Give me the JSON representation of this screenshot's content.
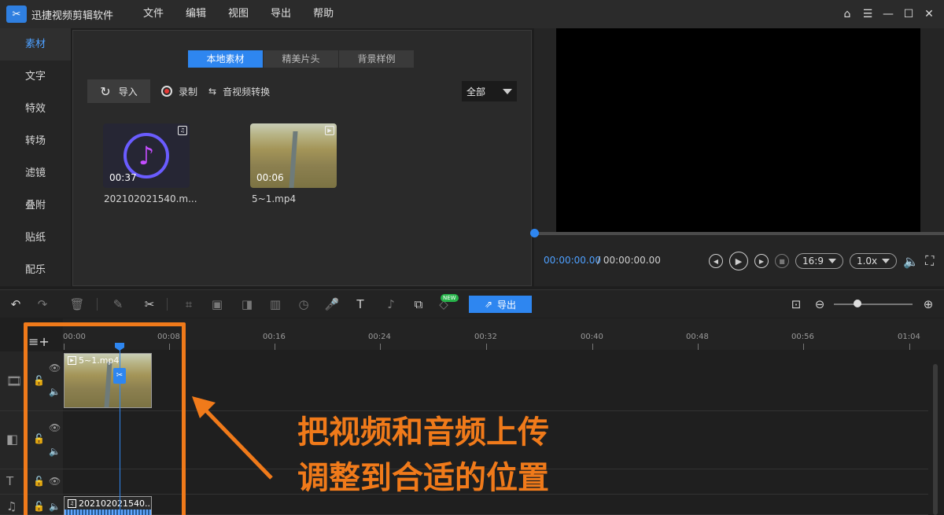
{
  "app": {
    "title": "迅捷视频剪辑软件",
    "menu": [
      "文件",
      "编辑",
      "视图",
      "导出",
      "帮助"
    ]
  },
  "sidebar": {
    "items": [
      "素材",
      "文字",
      "特效",
      "转场",
      "滤镜",
      "叠附",
      "贴纸",
      "配乐"
    ],
    "active": "素材"
  },
  "library": {
    "tabs": [
      "本地素材",
      "精美片头",
      "背景样例"
    ],
    "active_tab": "本地素材",
    "import_label": "导入",
    "record_label": "录制",
    "convert_label": "音视频转换",
    "filter_value": "全部",
    "items": [
      {
        "name": "202102021540.m...",
        "duration": "00:37",
        "kind": "audio"
      },
      {
        "name": "5~1.mp4",
        "duration": "00:06",
        "kind": "video"
      }
    ]
  },
  "preview": {
    "time_current": "00:00:00.00",
    "time_total": "/ 00:00:00.00",
    "aspect": "16:9",
    "speed": "1.0x"
  },
  "toolbar": {
    "export_label": "导出",
    "new_badge": "NEW"
  },
  "timeline": {
    "ticks": [
      "00:00",
      "00:08",
      "00:16",
      "00:24",
      "00:32",
      "00:40",
      "00:48",
      "00:56",
      "01:04"
    ],
    "video_clip": "5~1.mp4",
    "audio_clip": "202102021540..."
  },
  "annotation": {
    "line1": "把视频和音频上传",
    "line2": "调整到合适的位置",
    "color": "#f07a1a"
  }
}
